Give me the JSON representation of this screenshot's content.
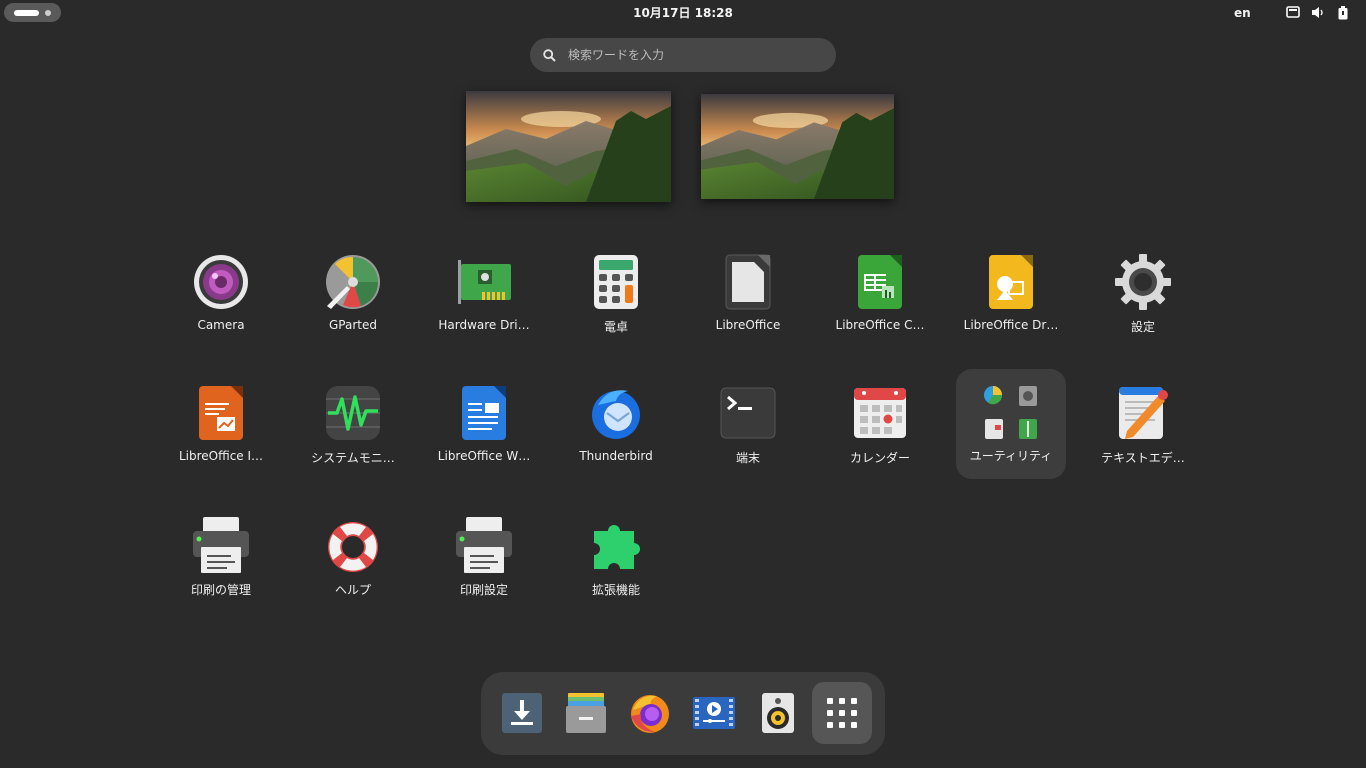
{
  "topbar": {
    "clock": "10月17日  18:28",
    "language": "en",
    "tray_icons": [
      "screen-icon",
      "volume-icon",
      "battery-icon"
    ]
  },
  "search": {
    "placeholder": "検索ワードを入力"
  },
  "workspaces": [
    {
      "name": "workspace-1"
    },
    {
      "name": "workspace-2"
    }
  ],
  "apps": [
    {
      "label": "Camera",
      "icon": "camera-icon"
    },
    {
      "label": "GParted",
      "icon": "gparted-icon"
    },
    {
      "label": "Hardware Dri…",
      "icon": "hardware-drivers-icon"
    },
    {
      "label": "電卓",
      "icon": "calculator-icon"
    },
    {
      "label": "LibreOffice",
      "icon": "libreoffice-icon"
    },
    {
      "label": "LibreOffice C…",
      "icon": "libreoffice-calc-icon"
    },
    {
      "label": "LibreOffice Dr…",
      "icon": "libreoffice-draw-icon"
    },
    {
      "label": "設定",
      "icon": "settings-gear-icon"
    },
    {
      "label": "LibreOffice I…",
      "icon": "libreoffice-impress-icon"
    },
    {
      "label": "システムモニ…",
      "icon": "system-monitor-icon"
    },
    {
      "label": "LibreOffice W…",
      "icon": "libreoffice-writer-icon"
    },
    {
      "label": "Thunderbird",
      "icon": "thunderbird-icon"
    },
    {
      "label": "端末",
      "icon": "terminal-icon"
    },
    {
      "label": "カレンダー",
      "icon": "calendar-icon"
    },
    {
      "label": "ユーティリティ",
      "icon": "utilities-folder-icon"
    },
    {
      "label": "テキストエデ…",
      "icon": "text-editor-icon"
    },
    {
      "label": "印刷の管理",
      "icon": "print-manager-icon"
    },
    {
      "label": "ヘルプ",
      "icon": "help-lifebuoy-icon"
    },
    {
      "label": "印刷設定",
      "icon": "print-settings-icon"
    },
    {
      "label": "拡張機能",
      "icon": "extensions-puzzle-icon"
    }
  ],
  "dock": [
    {
      "name": "downloads",
      "icon": "download-icon"
    },
    {
      "name": "files",
      "icon": "file-cabinet-icon"
    },
    {
      "name": "firefox",
      "icon": "firefox-icon"
    },
    {
      "name": "videos",
      "icon": "video-player-icon"
    },
    {
      "name": "rhythmbox",
      "icon": "speaker-icon"
    },
    {
      "name": "show-applications",
      "icon": "app-grid-icon"
    }
  ],
  "colors": {
    "background": "#2a2a2a",
    "search_bg": "#474747",
    "dock_bg": "#3b3b3b",
    "selected_tile": "#3d3d3d"
  }
}
